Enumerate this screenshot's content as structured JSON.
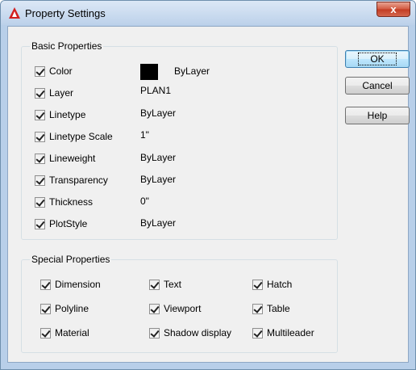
{
  "window": {
    "title": "Property Settings",
    "close_glyph": "x"
  },
  "basic": {
    "legend": "Basic Properties",
    "color_swatch": "#000000",
    "items": [
      {
        "label": "Color",
        "value": "ByLayer"
      },
      {
        "label": "Layer",
        "value": "PLAN1"
      },
      {
        "label": "Linetype",
        "value": "ByLayer"
      },
      {
        "label": "Linetype Scale",
        "value": "1\""
      },
      {
        "label": "Lineweight",
        "value": "ByLayer"
      },
      {
        "label": "Transparency",
        "value": "ByLayer"
      },
      {
        "label": "Thickness",
        "value": "0\""
      },
      {
        "label": "PlotStyle",
        "value": "ByLayer"
      }
    ]
  },
  "special": {
    "legend": "Special Properties",
    "items": [
      "Dimension",
      "Text",
      "Hatch",
      "Polyline",
      "Viewport",
      "Table",
      "Material",
      "Shadow display",
      "Multileader"
    ]
  },
  "buttons": {
    "ok": "OK",
    "cancel": "Cancel",
    "help": "Help"
  }
}
